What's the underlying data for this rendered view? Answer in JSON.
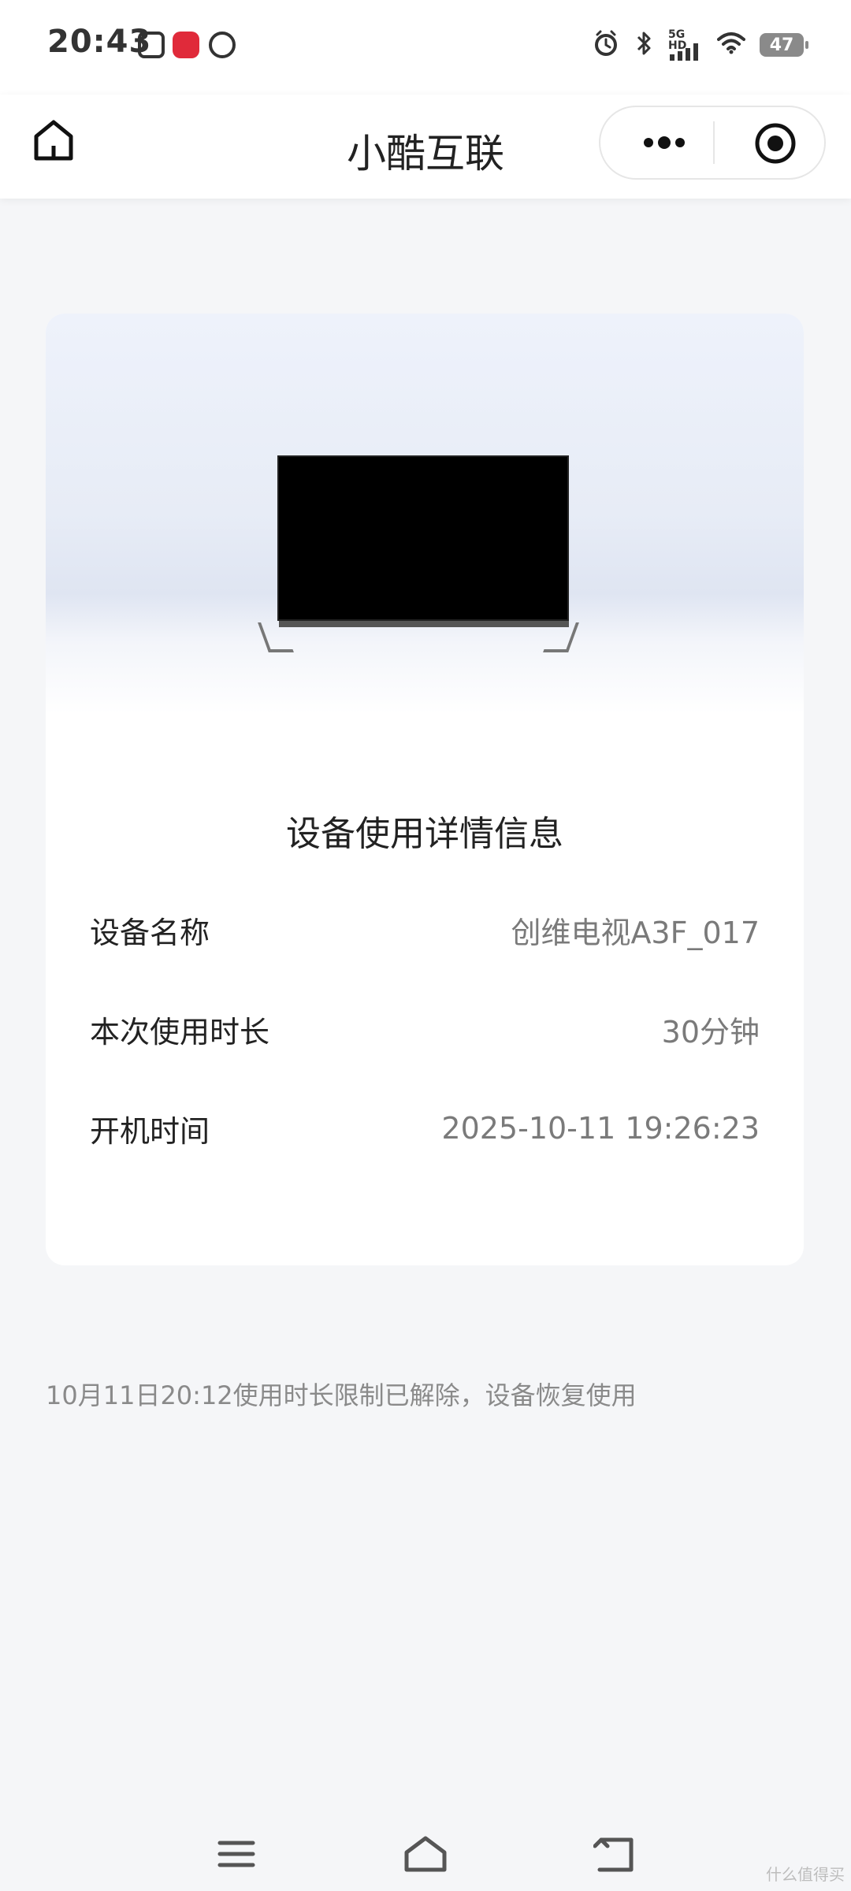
{
  "status_bar": {
    "time": "20:43",
    "network": "5G HD",
    "battery": "47",
    "icons": [
      "app-icon-a",
      "app-icon-b",
      "app-icon-c",
      "alarm-icon",
      "bluetooth-icon",
      "signal-icon",
      "wifi-icon",
      "battery-icon"
    ]
  },
  "header": {
    "title": "小酷互联",
    "home_icon": "home-icon",
    "more_icon": "more-dots-icon",
    "close_icon": "target-close-icon"
  },
  "card": {
    "section_title": "设备使用详情信息",
    "rows": [
      {
        "label": "设备名称",
        "value": "创维电视A3F_017"
      },
      {
        "label": "本次使用时长",
        "value": "30分钟"
      },
      {
        "label": "开机时间",
        "value": "2025-10-11 19:26:23"
      }
    ]
  },
  "notice": "10月11日20:12使用时长限制已解除，设备恢复使用",
  "bottom_nav": {
    "icons": [
      "menu-icon",
      "home-icon",
      "back-icon"
    ]
  },
  "watermark": "什么值得买",
  "colors": {
    "background": "#f5f6f8",
    "card": "#ffffff",
    "muted_text": "#8a8a8a"
  }
}
